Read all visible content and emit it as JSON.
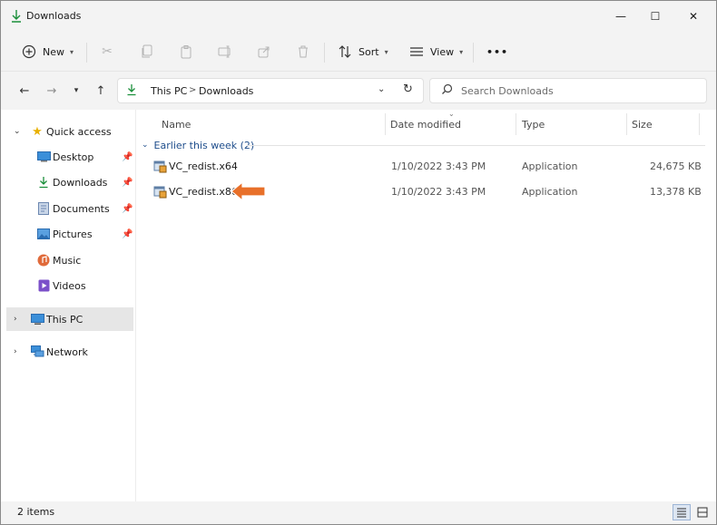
{
  "window": {
    "title": "Downloads",
    "controls": {
      "minimize": "—",
      "maximize": "☐",
      "close": "✕"
    }
  },
  "toolbar": {
    "new_label": "New",
    "sort_label": "Sort",
    "view_label": "View",
    "more_label": "•••"
  },
  "address": {
    "crumbs": [
      "This PC",
      "Downloads"
    ],
    "separator": ">"
  },
  "search": {
    "placeholder": "Search Downloads"
  },
  "sidebar": {
    "quick_access": "Quick access",
    "items": [
      {
        "label": "Desktop",
        "icon": "desktop-icon"
      },
      {
        "label": "Downloads",
        "icon": "downloads-icon"
      },
      {
        "label": "Documents",
        "icon": "documents-icon"
      },
      {
        "label": "Pictures",
        "icon": "pictures-icon"
      },
      {
        "label": "Music",
        "icon": "music-icon"
      },
      {
        "label": "Videos",
        "icon": "videos-icon"
      }
    ],
    "this_pc": "This PC",
    "network": "Network"
  },
  "columns": {
    "name": "Name",
    "date_modified": "Date modified",
    "type": "Type",
    "size": "Size"
  },
  "group": {
    "label": "Earlier this week (2)"
  },
  "files": [
    {
      "name": "VC_redist.x64",
      "date": "1/10/2022 3:43 PM",
      "type": "Application",
      "size": "24,675 KB"
    },
    {
      "name": "VC_redist.x86",
      "date": "1/10/2022 3:43 PM",
      "type": "Application",
      "size": "13,378 KB"
    }
  ],
  "status": {
    "count": "2 items"
  },
  "colors": {
    "accent_blue": "#1f4e8c",
    "folder_green": "#1a8f3a",
    "callout_orange": "#e8702a"
  }
}
